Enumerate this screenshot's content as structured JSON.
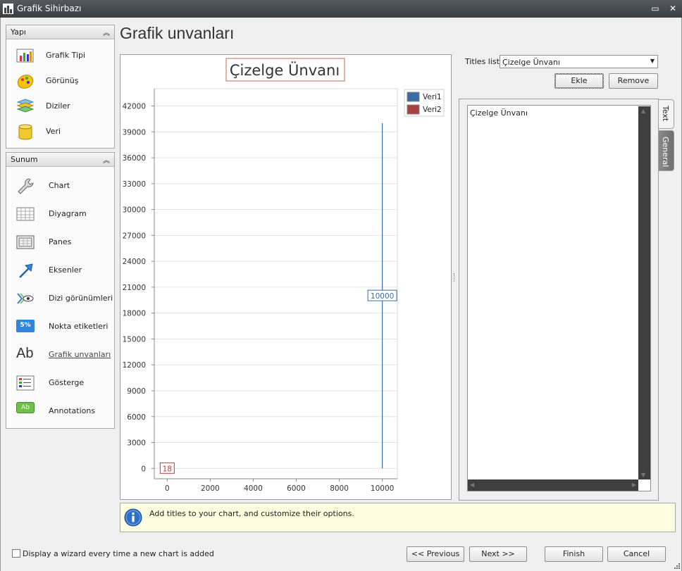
{
  "window": {
    "title": "Grafik Sihirbazı",
    "minimize_glyph": "▭",
    "close_glyph": "✕"
  },
  "nav": {
    "yapi": {
      "header": "Yapı",
      "items": [
        {
          "label": "Grafik Tipi",
          "icon": "bar-chart-icon"
        },
        {
          "label": "Görünüş",
          "icon": "palette-icon"
        },
        {
          "label": "Diziler",
          "icon": "layers-icon"
        },
        {
          "label": "Veri",
          "icon": "database-icon"
        }
      ]
    },
    "sunum": {
      "header": "Sunum",
      "items": [
        {
          "label": "Chart",
          "icon": "wrench-icon"
        },
        {
          "label": "Diyagram",
          "icon": "grid-icon"
        },
        {
          "label": "Panes",
          "icon": "panes-icon"
        },
        {
          "label": "Eksenler",
          "icon": "axis-arrow-icon"
        },
        {
          "label": "Dizi görünümleri",
          "icon": "series-view-icon"
        },
        {
          "label": "Nokta etiketleri",
          "icon": "point-label-icon",
          "badge": "5%"
        },
        {
          "label": "Grafik unvanları",
          "icon": "title-ab-icon",
          "glyph": "Ab",
          "active": true
        },
        {
          "label": "Gösterge",
          "icon": "legend-icon"
        },
        {
          "label": "Annotations",
          "icon": "annotation-icon",
          "glyph": "Ab"
        }
      ]
    }
  },
  "page_title": "Grafik unvanları",
  "chart_data": {
    "type": "line",
    "title": "Çizelge Ünvanı",
    "x_ticks": [
      "0",
      "2000",
      "4000",
      "6000",
      "8000",
      "10000"
    ],
    "y_ticks": [
      "0",
      "3000",
      "6000",
      "9000",
      "12000",
      "15000",
      "18000",
      "21000",
      "24000",
      "27000",
      "30000",
      "33000",
      "36000",
      "39000",
      "42000"
    ],
    "xlim": [
      -600,
      10700
    ],
    "ylim": [
      -1200,
      44000
    ],
    "series": [
      {
        "name": "Veri1",
        "color": "#3b6aa5",
        "x": [
          10000,
          10000
        ],
        "y": [
          0,
          40000
        ],
        "label": "10000",
        "label_at": [
          10000,
          20000
        ]
      },
      {
        "name": "Veri2",
        "color": "#a94040",
        "x": [
          0
        ],
        "y": [
          0
        ],
        "label": "18",
        "label_at": [
          0,
          0
        ]
      }
    ],
    "legend_position": "top-right",
    "grid": true
  },
  "options": {
    "titles_list_label": "Titles list:",
    "titles_list_value": "Çizelge Ünvanı",
    "add_button": "Ekle",
    "remove_button": "Remove",
    "text_value": "Çizelge Ünvanı",
    "tabs": [
      {
        "label": "Text",
        "selected": true
      },
      {
        "label": "General",
        "selected": false
      }
    ]
  },
  "hint": {
    "icon": "info-icon",
    "text": "Add titles to your chart, and customize their options."
  },
  "footer": {
    "checkbox_label": "Display a wizard every time a new chart is added",
    "checkbox_checked": false,
    "previous": "<< Previous",
    "next": "Next >>",
    "finish": "Finish",
    "cancel": "Cancel"
  }
}
